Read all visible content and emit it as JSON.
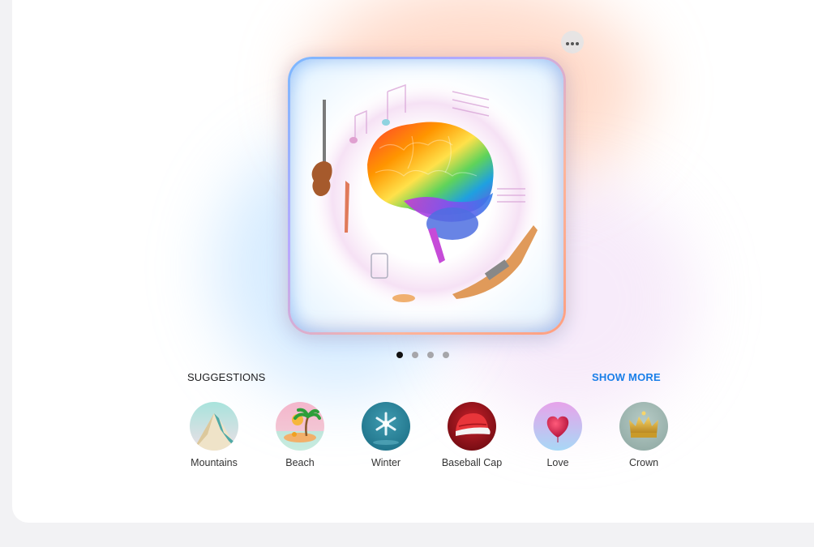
{
  "image_viewer": {
    "more_button_icon": "ellipsis-icon",
    "image_description": "Colored-pencil illustration of a rainbow brain surrounded by musical instruments and notes",
    "pages": {
      "total": 4,
      "current": 1
    }
  },
  "suggestions": {
    "title": "SUGGESTIONS",
    "show_more_label": "SHOW MORE",
    "accent_color": "#1a7fe8",
    "items": [
      {
        "label": "Mountains",
        "icon": "mountain-icon"
      },
      {
        "label": "Beach",
        "icon": "palm-tree-icon"
      },
      {
        "label": "Winter",
        "icon": "snowflake-icon"
      },
      {
        "label": "Baseball Cap",
        "icon": "baseball-cap-icon"
      },
      {
        "label": "Love",
        "icon": "heart-icon"
      },
      {
        "label": "Crown",
        "icon": "crown-icon"
      }
    ]
  }
}
